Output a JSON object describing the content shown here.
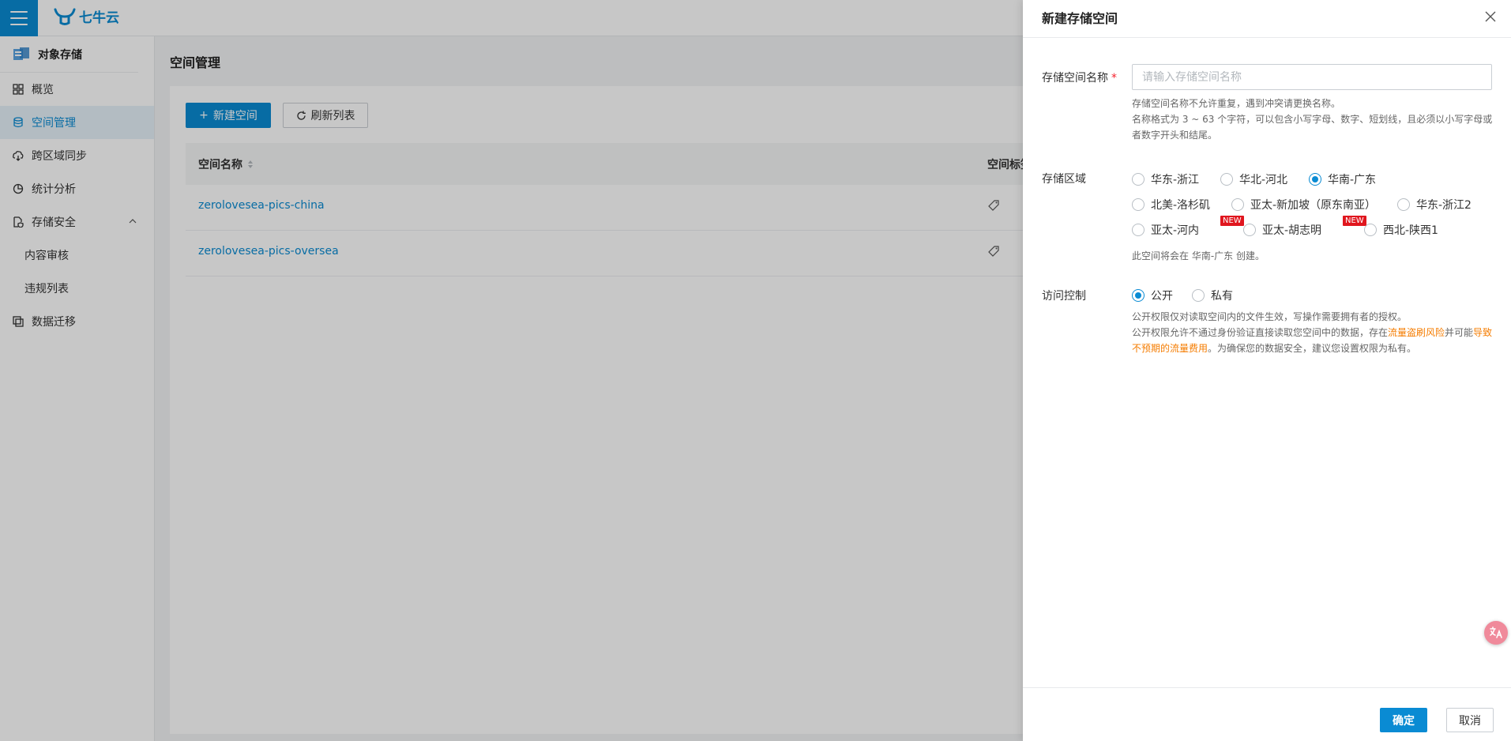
{
  "app": {
    "logo_text": "七牛云"
  },
  "sidebar": {
    "title": "对象存储",
    "items": [
      {
        "label": "概览"
      },
      {
        "label": "空间管理"
      },
      {
        "label": "跨区域同步"
      },
      {
        "label": "统计分析"
      },
      {
        "label": "存储安全"
      },
      {
        "label": "内容审核"
      },
      {
        "label": "违规列表"
      },
      {
        "label": "数据迁移"
      }
    ]
  },
  "main": {
    "page_title": "空间管理",
    "new_button": "新建空间",
    "refresh_button": "刷新列表",
    "table": {
      "col_name": "空间名称",
      "col_tag": "空间标签",
      "rows": [
        {
          "name": "zerolovesea-pics-china"
        },
        {
          "name": "zerolovesea-pics-oversea"
        }
      ]
    }
  },
  "drawer": {
    "title": "新建存储空间",
    "name_label": "存储空间名称",
    "required_mark": "*",
    "name_placeholder": "请输入存储空间名称",
    "name_value": "",
    "name_help_1": "存储空间名称不允许重复，遇到冲突请更换名称。",
    "name_help_2": "名称格式为 3 ~ 63 个字符，可以包含小写字母、数字、短划线，且必须以小写字母或者数字开头和结尾。",
    "region_label": "存储区域",
    "regions": [
      {
        "label": "华东-浙江",
        "selected": false
      },
      {
        "label": "华北-河北",
        "selected": false
      },
      {
        "label": "华南-广东",
        "selected": true
      },
      {
        "label": "北美-洛杉矶",
        "selected": false
      },
      {
        "label": "亚太-新加坡（原东南亚）",
        "selected": false
      },
      {
        "label": "华东-浙江2",
        "selected": false
      },
      {
        "label": "亚太-河内",
        "selected": false,
        "badge": "NEW"
      },
      {
        "label": "亚太-胡志明",
        "selected": false,
        "badge": "NEW"
      },
      {
        "label": "西北-陕西1",
        "selected": false
      }
    ],
    "region_help_prefix": "此空间将会在",
    "region_help_region": "华南-广东",
    "region_help_suffix": "创建。",
    "access_label": "访问控制",
    "access_options": [
      {
        "label": "公开",
        "selected": true
      },
      {
        "label": "私有",
        "selected": false
      }
    ],
    "access_help_1": "公开权限仅对读取空间内的文件生效，写操作需要拥有者的授权。",
    "access_help_2a": "公开权限允许不通过身份验证直接读取您空间中的数据，存在",
    "access_help_2b": "流量盗刷风险",
    "access_help_2c": "并可能",
    "access_help_2d": "导致不预期的流量费用",
    "access_help_2e": "。为确保您的数据安全，建议您设置权限为私有。",
    "ok_button": "确定",
    "cancel_button": "取消"
  },
  "colors": {
    "primary": "#0a8bd3",
    "danger": "#e0161e",
    "warning": "#f57c00"
  }
}
